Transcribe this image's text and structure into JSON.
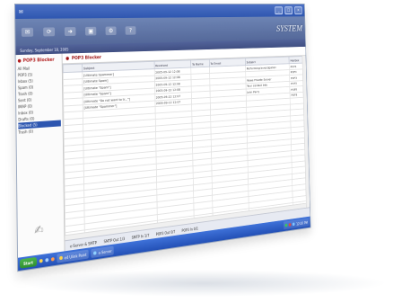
{
  "window": {
    "title": "",
    "brand": "SYSTEM",
    "date": "Sunday, September 18, 2005"
  },
  "toolbar": {
    "labels": [
      "",
      "",
      "",
      "",
      "",
      ""
    ]
  },
  "sidebar": {
    "title": "POP3 Blocker",
    "items": [
      "All Mail",
      "POP3 (5)",
      "Inbox (5)",
      "Spam (0)",
      "Trash (0)",
      "Sent (0)",
      "IMAP (0)",
      "Inbox (0)",
      "Drafts (0)",
      "Blocked (5)",
      "Trash (0)"
    ],
    "footer_line1": "",
    "footer_line2": ""
  },
  "content": {
    "title": "POP3 Blocker",
    "columns": [
      "",
      "Subject",
      "Received",
      "To Name",
      "To Email",
      "Subject",
      "Mailbox"
    ],
    "rows": [
      [
        "",
        "[Ultimate Spammer]",
        "2005-09-12 12:08",
        "",
        "",
        "Performing Investigation",
        "POP3"
      ],
      [
        "",
        "[Ultimate Spam]",
        "2005-09-12 12:08",
        "",
        "",
        "",
        "POP3"
      ],
      [
        "",
        "[Ultimate \"Spam\"]",
        "2005-09-12 12:08",
        "",
        "",
        "Rewe Private Server",
        "POP3"
      ],
      [
        "",
        "[Ultimate \"Spam\"]",
        "2005-09-12 12:08",
        "",
        "",
        "Your contact info",
        "POP3"
      ],
      [
        "",
        "[Ultimate \"Do not want to tr...\"]",
        "2005-09-12 12:07",
        "",
        "",
        "John Parry",
        "POP3"
      ],
      [
        "",
        "[Ultimate \"Spammer\"]",
        "2005-09-12 12:07",
        "",
        "",
        "",
        "POP3"
      ]
    ]
  },
  "bottom_tabs": [
    "e-Server & SMTP",
    "SMTP Out 1/3",
    "SMTP In 1/7",
    "POP3 Out 0/7",
    "POP3 In 0/1"
  ],
  "taskbar": {
    "start": "Start",
    "items": [
      "e4 Ulink Paint",
      "e-Server"
    ],
    "clock": "12:20 PM"
  }
}
